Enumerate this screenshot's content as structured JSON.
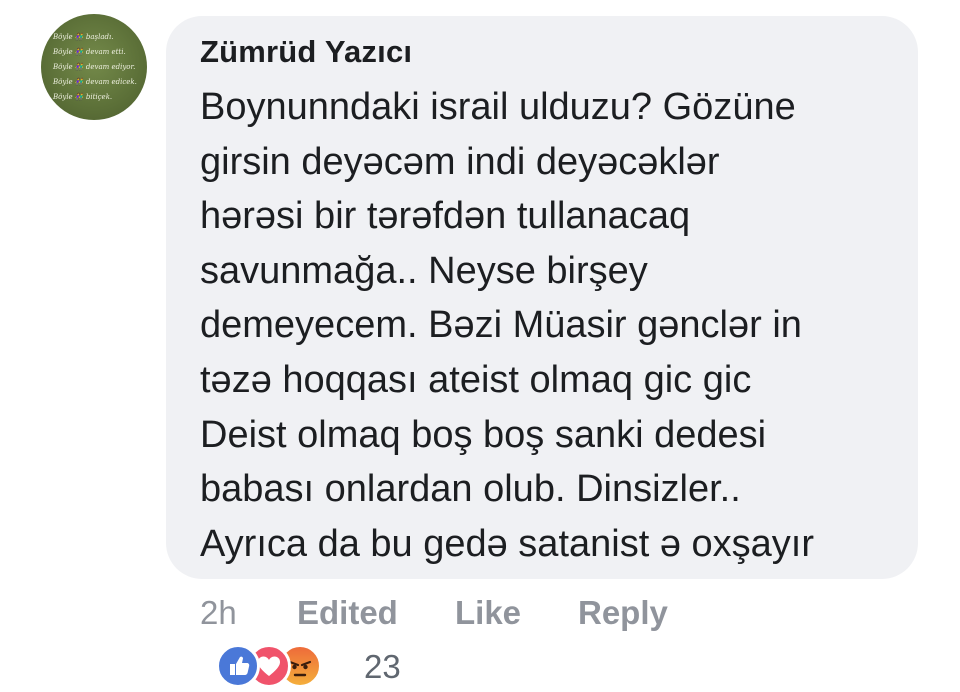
{
  "comment": {
    "author": "Zümrüd Yazıcı",
    "avatar_lines": [
      "Böyle 👫 başladı.",
      "Böyle 👫 devam etti.",
      "Böyle 👫 devam ediyor.",
      "Böyle 👫 devam edicek.",
      "Böyle 👫 bitiçek."
    ],
    "body_lines": [
      "Boynunndaki israil ulduzu? Gözüne",
      "girsin deyəcəm indi deyəcəklər",
      "hərəsi bir tərəfdən tullanacaq",
      "savunmağa.. Neyse birşey",
      "demeyecem. Bəzi Müasir gənclər in",
      "təzə hoqqası ateist olmaq gic gic",
      "Deist olmaq boş boş sanki dedesi",
      "babası onlardan olub. Dinsizler..",
      "Ayrıca da bu gedə satanist ə oxşayır"
    ]
  },
  "actions": {
    "time": "2h",
    "edited": "Edited",
    "like": "Like",
    "reply": "Reply"
  },
  "reactions": {
    "icons": [
      "like-icon",
      "love-icon",
      "angry-icon"
    ],
    "count": "23"
  },
  "colors": {
    "bubble": "#f0f1f4",
    "text": "#1c1e21",
    "meta": "#90949c",
    "like_blue": "#4a78d8",
    "love_red": "#f0536b",
    "angry_orange": "#ee6b3a"
  }
}
